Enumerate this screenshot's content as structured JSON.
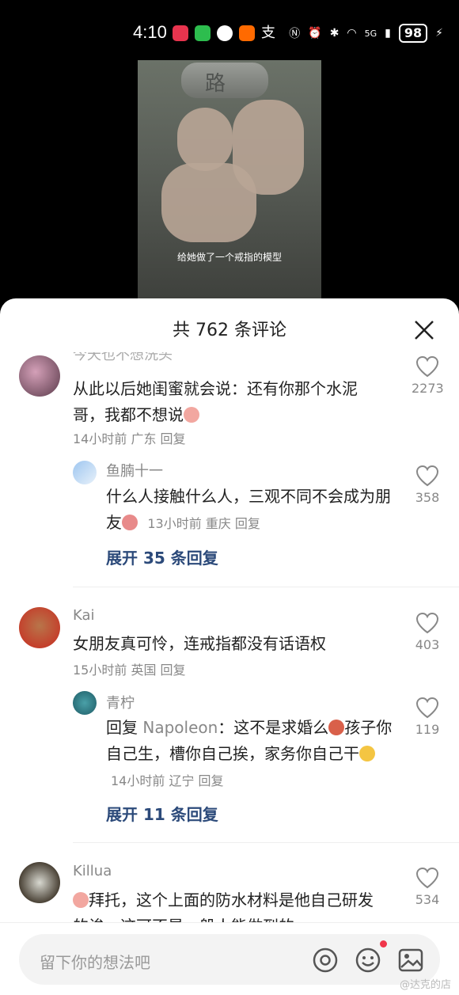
{
  "status_bar": {
    "time": "4:10",
    "network": "5G",
    "battery": "98"
  },
  "video": {
    "ring_char": "路",
    "caption": "给她做了一个戒指的模型"
  },
  "sheet": {
    "title": "共 762 条评论"
  },
  "comments": [
    {
      "name_partial": "今天也不想洗头",
      "text": "从此以后她闺蜜就会说：还有你那个水泥哥，我都不想说",
      "meta": "14小时前  广东  回复",
      "likes": "2273",
      "reply": {
        "name": "鱼腩十一",
        "text": "什么人接触什么人，三观不同不会成为朋友",
        "meta": "13小时前  重庆  回复",
        "likes": "358"
      },
      "expand": "展开 35 条回复"
    },
    {
      "name": "Kai",
      "text": "女朋友真可怜，连戒指都没有话语权",
      "meta": "15小时前  英国  回复",
      "likes": "403",
      "reply": {
        "name": "青柠",
        "reply_prefix": "回复",
        "reply_to": "Napoleon",
        "text": "：这不是求婚么",
        "text2": "孩子你自己生，槽你自己挨，家务你自己干",
        "meta": "14小时前  辽宁  回复",
        "likes": "119"
      },
      "expand": "展开 11 条回复"
    },
    {
      "name": "Killua",
      "text": "拜托，这个上面的防水材料是他自己研发的诶，这可不是一般人能做到的",
      "likes": "534"
    }
  ],
  "input": {
    "placeholder": "留下你的想法吧"
  },
  "watermark": "@达克的店"
}
